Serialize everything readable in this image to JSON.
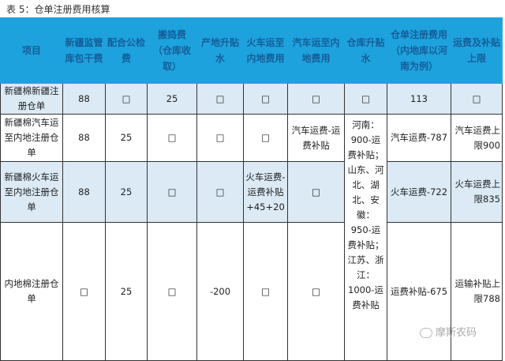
{
  "caption": "表 5：仓单注册费用核算",
  "headers": [
    "项目",
    "新疆监管库包干费",
    "配合公检费",
    "搬捣费（仓库收取）",
    "产地升贴水",
    "火车运至内地费用",
    "汽车运至内地费用",
    "仓库升贴水",
    "仓单注册费用（内地库以河南为例）",
    "运费及补贴上限"
  ],
  "rows": [
    {
      "item": "新疆棉新疆注册仓单",
      "c1": "88",
      "c2": "□",
      "c3": "25",
      "c4": "□",
      "c5": "□",
      "c6": "□",
      "c7": "□",
      "c8": "113",
      "c9": "□"
    },
    {
      "item": "新疆棉汽车运至内地注册仓单",
      "c1": "88",
      "c2": "25",
      "c3": "□",
      "c4": "□",
      "c5": "□",
      "c6": "汽车运费-运费补贴",
      "c7": "河南：900-运费补贴；山东、河北、湖北、安徽：950-运费补贴；江苏、浙江：1000-运费补贴",
      "c8": "汽车运费-787",
      "c9": "汽车运费上限900"
    },
    {
      "item": "新疆棉火车运至内地注册仓单",
      "c1": "88",
      "c2": "25",
      "c3": "□",
      "c4": "□",
      "c5": "火车运费-运费补贴+45+20",
      "c6": "□",
      "c8": "火车运费-722",
      "c9": "火车运费上限835"
    },
    {
      "item": "内地棉注册仓单",
      "c1": "□",
      "c2": "25",
      "c3": "□",
      "c4": "-200",
      "c5": "□",
      "c6": "□",
      "c8": "运费补贴-675",
      "c9": "运输补贴上限788"
    }
  ],
  "watermark": "摩斯农码"
}
